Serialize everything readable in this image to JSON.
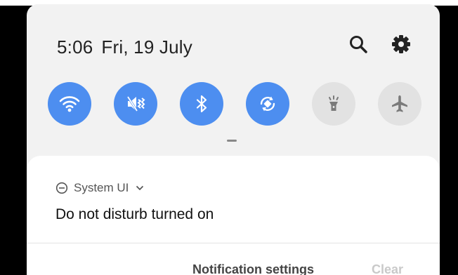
{
  "status": {
    "time": "5:06",
    "date": "Fri, 19 July"
  },
  "header": {
    "search_icon": "search-icon",
    "settings_icon": "gear-icon"
  },
  "quick_settings": [
    {
      "name": "wifi",
      "icon": "wifi-icon",
      "active": true
    },
    {
      "name": "sound",
      "icon": "mute-icon",
      "active": true
    },
    {
      "name": "bluetooth",
      "icon": "bluetooth-icon",
      "active": true
    },
    {
      "name": "auto-rotate",
      "icon": "rotate-icon",
      "active": true
    },
    {
      "name": "flashlight",
      "icon": "flashlight-icon",
      "active": false
    },
    {
      "name": "airplane-mode",
      "icon": "airplane-icon",
      "active": false
    }
  ],
  "notification": {
    "app_name": "System UI",
    "title": "Do not disturb turned on",
    "actions": {
      "settings_label": "Notification settings",
      "clear_label": "Clear"
    }
  },
  "colors": {
    "active": "#4d8ef0",
    "inactive": "#e2e2e2",
    "panel": "#f2f2f2"
  }
}
